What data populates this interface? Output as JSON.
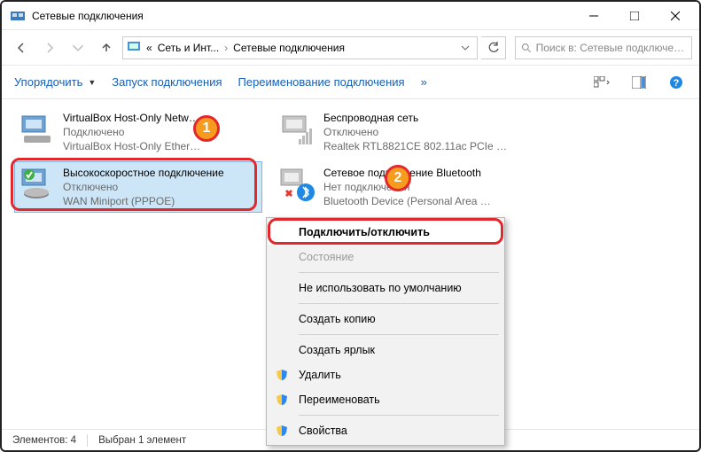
{
  "title": "Сетевые подключения",
  "breadcrumb": {
    "prefix": "«",
    "part1": "Сеть и Инт...",
    "part2": "Сетевые подключения"
  },
  "search": {
    "placeholder": "Поиск в: Сетевые подключения"
  },
  "toolbar": {
    "organize": "Упорядочить",
    "start": "Запуск подключения",
    "rename": "Переименование подключения",
    "more": "»"
  },
  "connections": [
    {
      "name": "VirtualBox Host-Only Netw…",
      "status": "Подключено",
      "device": "VirtualBox Host-Only Ether…"
    },
    {
      "name": "Беспроводная сеть",
      "status": "Отключено",
      "device": "Realtek RTL8821CE 802.11ac PCIe …"
    },
    {
      "name": "Высокоскоростное подключение",
      "status": "Отключено",
      "device": "WAN Miniport (PPPOE)"
    },
    {
      "name": "Сетевое подключение Bluetooth",
      "status": "Нет подключения",
      "device": "Bluetooth Device (Personal Area …"
    }
  ],
  "context_menu": {
    "connect": "Подключить/отключить",
    "status": "Состояние",
    "nodefault": "Не использовать по умолчанию",
    "copy": "Создать копию",
    "shortcut": "Создать ярлык",
    "delete": "Удалить",
    "rename": "Переименовать",
    "properties": "Свойства"
  },
  "statusbar": {
    "count": "Элементов: 4",
    "selected": "Выбран 1 элемент"
  },
  "callouts": {
    "one": "1",
    "two": "2"
  }
}
